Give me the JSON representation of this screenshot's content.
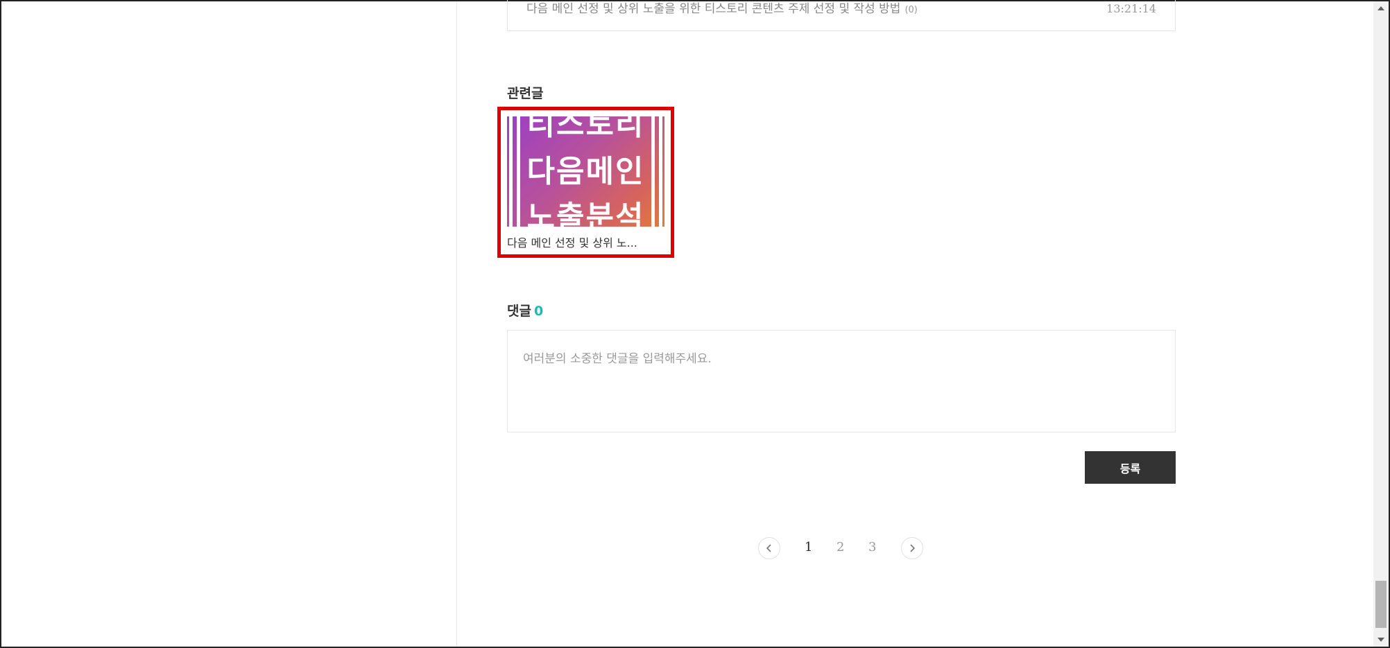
{
  "recent_post": {
    "title": "다음 메인 선정 및 상위 노출을 위한 티스토리 콘텐츠 주제 선정 및 작성 방법",
    "comment_count": "(0)",
    "time": "13:21:14"
  },
  "related": {
    "heading": "관련글",
    "items": [
      {
        "thumbnail_lines": [
          "티스토리",
          "다음메인",
          "노출분석"
        ],
        "caption": "다음 메인 선정 및 상위 노..."
      }
    ]
  },
  "comments": {
    "heading": "댓글",
    "count": "0",
    "placeholder": "여러분의 소중한 댓글을 입력해주세요.",
    "submit_label": "등록"
  },
  "pagination": {
    "pages": [
      "1",
      "2",
      "3"
    ],
    "current": "1",
    "prev_icon": "chevron-left-icon",
    "next_icon": "chevron-right-icon"
  },
  "colors": {
    "highlight_border": "#e00000",
    "comment_count": "#1fb7b7",
    "submit_button": "#333333"
  }
}
